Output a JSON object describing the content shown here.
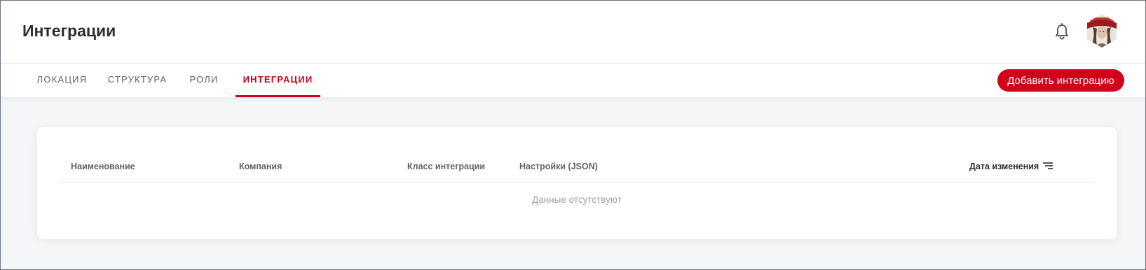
{
  "header": {
    "title": "Интеграции",
    "notifications_icon": "bell-icon",
    "avatar": "user-avatar"
  },
  "tabs": [
    {
      "label": "Локация",
      "active": false
    },
    {
      "label": "Структура",
      "active": false
    },
    {
      "label": "Роли",
      "active": false
    },
    {
      "label": "Интеграции",
      "active": true
    }
  ],
  "actions": {
    "add_integration_label": "Добавить интеграцию"
  },
  "table": {
    "columns": [
      {
        "label": "Наименование"
      },
      {
        "label": "Компания"
      },
      {
        "label": "Класс интеграции"
      },
      {
        "label": "Настройки (JSON)"
      },
      {
        "label": "Дата изменения",
        "sortable": true,
        "sort_icon": "sort-lines-icon"
      }
    ],
    "empty_text": "Данные отсутствуют"
  },
  "colors": {
    "accent": "#d0021b",
    "background": "#f5f6f8",
    "text_primary": "#2b2f33",
    "text_secondary": "#5f6368",
    "text_muted": "#a0a4a8"
  }
}
